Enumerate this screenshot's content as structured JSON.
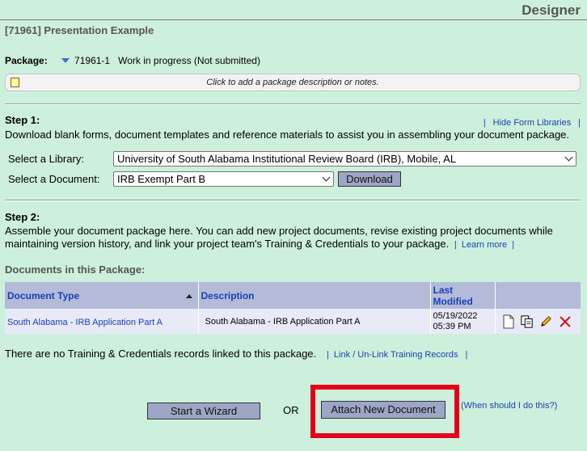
{
  "header": {
    "app_title": "Designer",
    "project_title": "[71961] Presentation Example"
  },
  "package": {
    "label": "Package:",
    "id": "71961-1",
    "status": "Work in progress (Not submitted)",
    "notes_prompt": "Click to add a package description or notes."
  },
  "step1": {
    "heading": "Step 1:",
    "text": "Download blank forms, document templates and reference materials to assist you in assembling your document package.",
    "hide_link": "Hide Form Libraries",
    "library_label": "Select a Library:",
    "library_value": "University of South Alabama Institutional Review Board (IRB), Mobile, AL",
    "document_label": "Select a Document:",
    "document_value": "IRB Exempt Part B",
    "download_label": "Download"
  },
  "step2": {
    "heading": "Step 2:",
    "text": "Assemble your document package here. You can add new project documents, revise existing project documents while maintaining version history, and link your project team's Training & Credentials to your package.",
    "learn_more": "Learn more"
  },
  "documents": {
    "section_label": "Documents in this Package:",
    "columns": [
      "Document Type",
      "Description",
      "Last Modified"
    ],
    "rows": [
      {
        "type": "South Alabama - IRB Application Part A",
        "description": "South Alabama - IRB Application Part A",
        "date": "05/19/2022",
        "time": "05:39 PM"
      }
    ]
  },
  "training": {
    "text": "There are no Training & Credentials records linked to this package.",
    "link": "Link / Un-Link Training Records"
  },
  "actions": {
    "wizard_label": "Start a Wizard",
    "or_label": "OR",
    "attach_label": "Attach New Document",
    "when_link": "(When should I do this?)"
  },
  "colors": {
    "background": "#cdf0dc",
    "link": "#1a3fb4",
    "table_header": "#b3bbd9",
    "button": "#9ea6c5",
    "highlight": "#e3001b"
  }
}
